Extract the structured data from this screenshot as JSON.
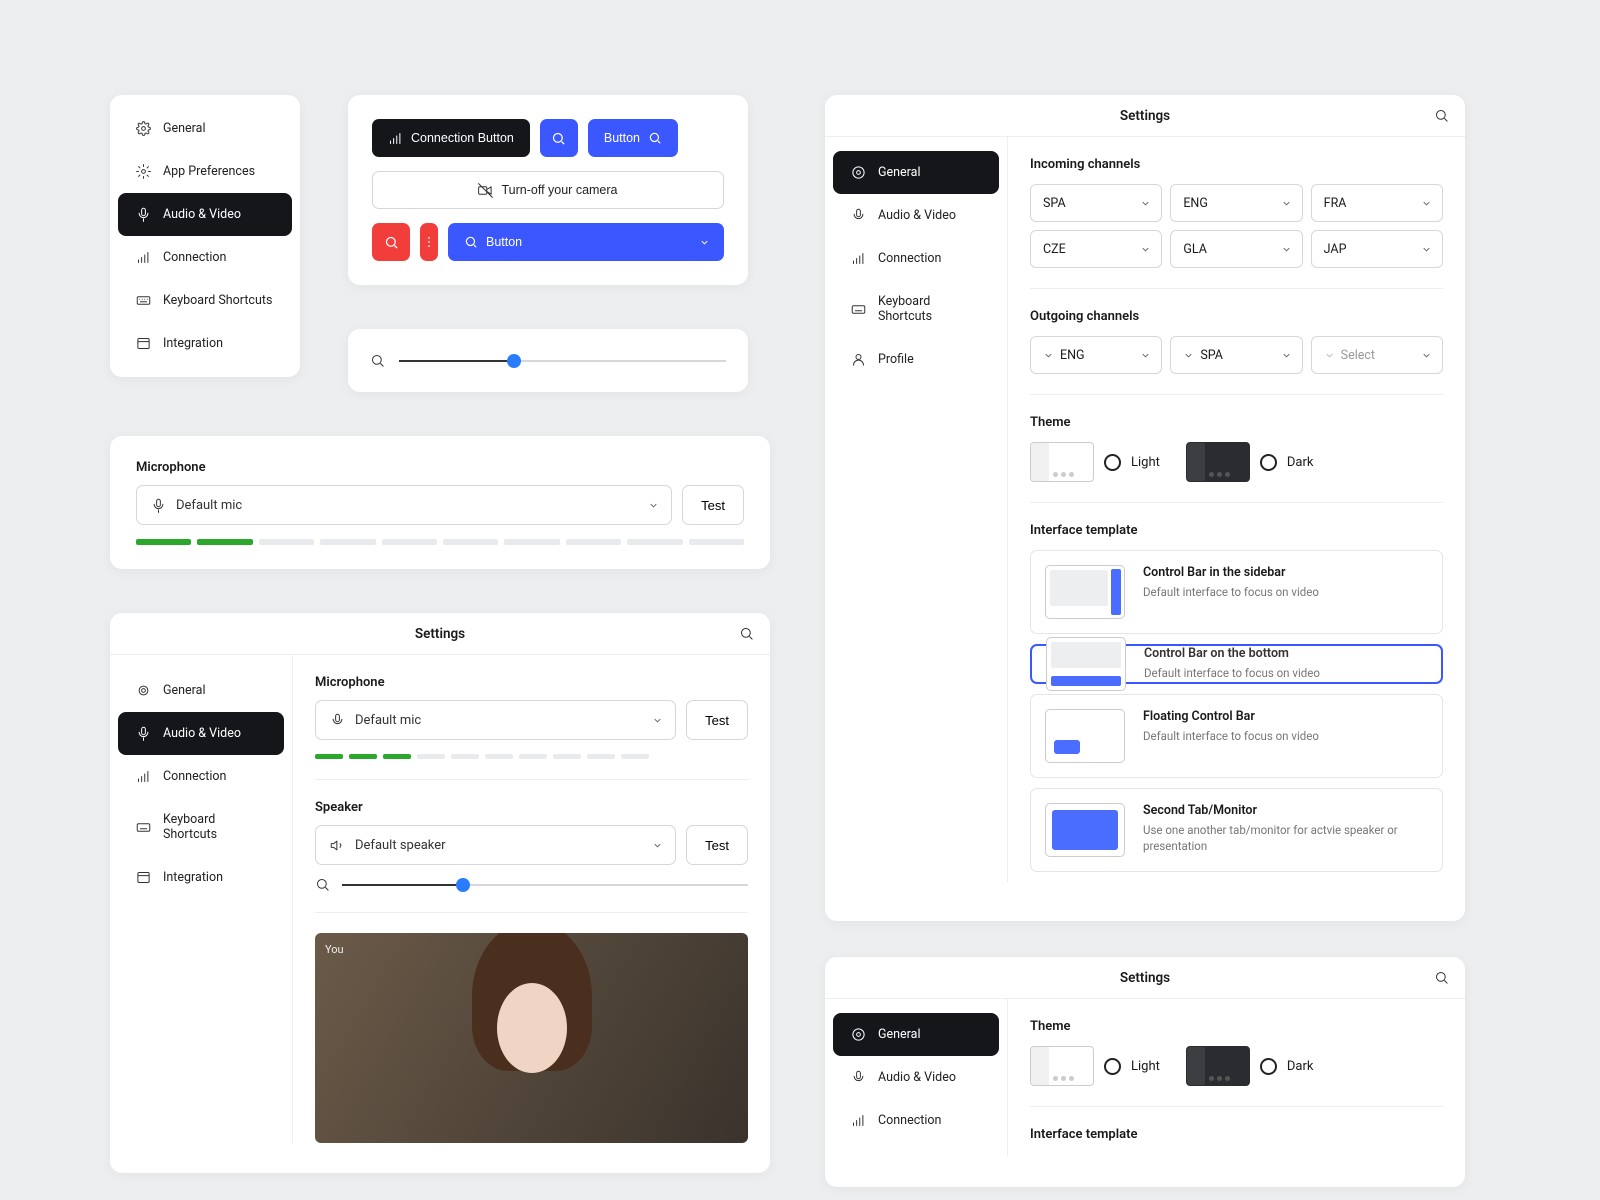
{
  "sidebar_small": {
    "items": [
      "General",
      "App Preferences",
      "Audio & Video",
      "Connection",
      "Keyboard Shortcuts",
      "Integration"
    ],
    "active_index": 2
  },
  "buttons_card": {
    "connection": "Connection Button",
    "button": "Button",
    "turn_off": "Turn-off your camera",
    "button2": "Button"
  },
  "mic_card": {
    "label": "Microphone",
    "value": "Default mic",
    "test": "Test"
  },
  "settings_left": {
    "title": "Settings",
    "side": [
      "General",
      "Audio & Video",
      "Connection",
      "Keyboard Shortcuts",
      "Integration"
    ],
    "side_active": 1,
    "mic_label": "Microphone",
    "mic_value": "Default mic",
    "spk_label": "Speaker",
    "spk_value": "Default speaker",
    "test": "Test",
    "you": "You"
  },
  "settings_right1": {
    "title": "Settings",
    "side": [
      "General",
      "Audio & Video",
      "Connection",
      "Keyboard Shortcuts",
      "Profile"
    ],
    "side_active": 0,
    "incoming_label": "Incoming channels",
    "incoming": [
      "SPA",
      "ENG",
      "FRA",
      "CZE",
      "GLA",
      "JAP"
    ],
    "outgoing_label": "Outgoing channels",
    "outgoing": [
      "ENG",
      "SPA"
    ],
    "outgoing_ph": "Select",
    "theme_label": "Theme",
    "theme_light": "Light",
    "theme_dark": "Dark",
    "tpl_label": "Interface template",
    "tpls": [
      {
        "t": "Control Bar in the sidebar",
        "d": "Default interface to focus on video"
      },
      {
        "t": "Control Bar on the bottom",
        "d": "Default interface to focus on video"
      },
      {
        "t": "Floating Control Bar",
        "d": "Default interface to focus on video"
      },
      {
        "t": "Second Tab/Monitor",
        "d": "Use one another tab/monitor for actvie speaker or presentation"
      }
    ]
  },
  "settings_right2": {
    "title": "Settings",
    "side": [
      "General",
      "Audio & Video",
      "Connection"
    ],
    "side_active": 0,
    "theme_label": "Theme",
    "theme_light": "Light",
    "theme_dark": "Dark",
    "tpl_label": "Interface template"
  }
}
